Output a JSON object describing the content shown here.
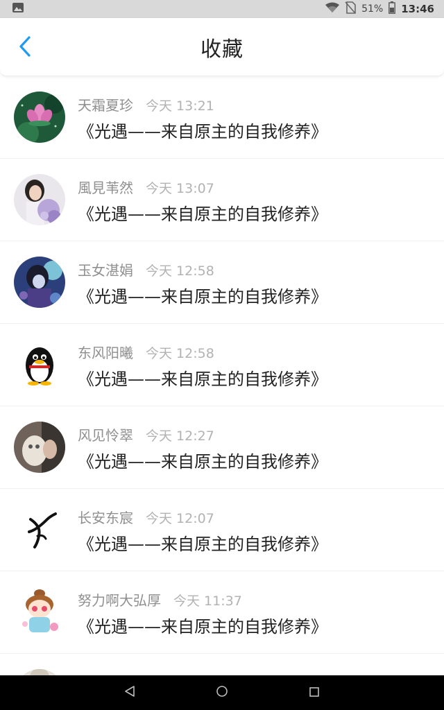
{
  "status_bar": {
    "battery_percent": "51%",
    "time": "13:46"
  },
  "header": {
    "title": "收藏"
  },
  "favorites": [
    {
      "user": "天霜夏珍",
      "time": "今天 13:21",
      "message": "《光遇——来自原主的自我修养》"
    },
    {
      "user": "風見苇然",
      "time": "今天 13:07",
      "message": "《光遇——来自原主的自我修养》"
    },
    {
      "user": "玉女湛娟",
      "time": "今天 12:58",
      "message": "《光遇——来自原主的自我修养》"
    },
    {
      "user": "东风阳曦",
      "time": "今天 12:58",
      "message": "《光遇——来自原主的自我修养》"
    },
    {
      "user": "风见怜翠",
      "time": "今天 12:27",
      "message": "《光遇——来自原主的自我修养》"
    },
    {
      "user": "长安东宸",
      "time": "今天 12:07",
      "message": "《光遇——来自原主的自我修养》"
    },
    {
      "user": "努力啊大弘厚",
      "time": "今天 11:37",
      "message": "《光遇——来自原主的自我修养》"
    }
  ],
  "colors": {
    "accent": "#1e9bf0",
    "title": "#222222",
    "username": "#8f8f8f",
    "timestamp": "#b2b2b2"
  },
  "icons": {
    "back": "chevron-left-icon",
    "nav_back": "triangle-back-icon",
    "nav_home": "circle-home-icon",
    "nav_recents": "square-recents-icon"
  }
}
